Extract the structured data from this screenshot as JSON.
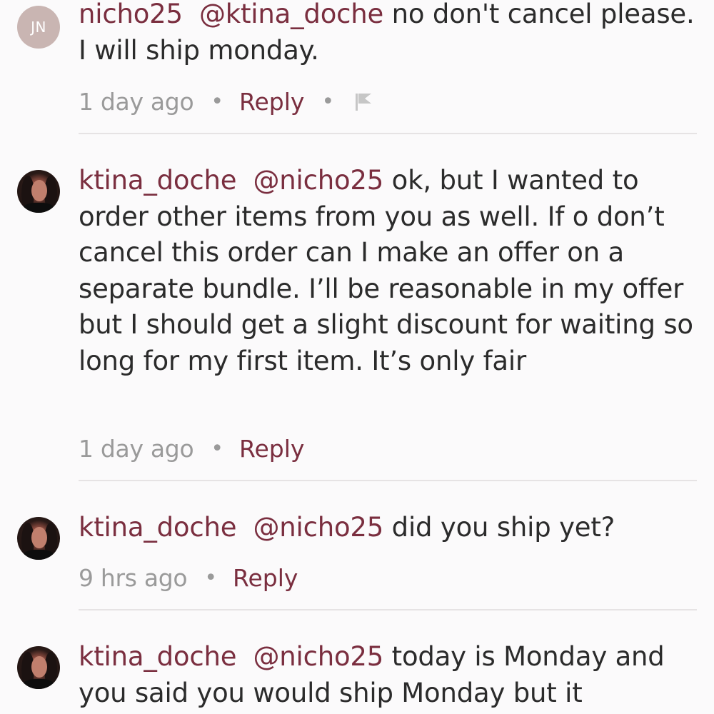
{
  "comments": [
    {
      "username": "nicho25",
      "mention": "@ktina_doche",
      "body": " no don't cancel please. I will ship monday.",
      "time": "1 day ago",
      "reply_label": "Reply",
      "avatar_initials": "JN",
      "has_flag": true
    },
    {
      "username": "ktina_doche",
      "mention": "@nicho25",
      "body": " ok, but I wanted to order other items from you as well. If o don’t cancel this order can I make an offer on a separate bundle. I’ll be reasonable in my offer but I should get a slight discount for waiting so long for my first item. It’s only fair",
      "time": "1 day ago",
      "reply_label": "Reply"
    },
    {
      "username": "ktina_doche",
      "mention": "@nicho25",
      "body": " did you ship yet?",
      "time": "9 hrs ago",
      "reply_label": "Reply"
    },
    {
      "username": "ktina_doche",
      "mention": "@nicho25",
      "body": " today is Monday and you said you would ship Monday but it"
    }
  ],
  "icons": {
    "separator": "•",
    "flag": "flag-icon"
  },
  "colors": {
    "accent": "#7a2e3f",
    "muted": "#9a9a9a",
    "divider": "#e6e3e4"
  }
}
